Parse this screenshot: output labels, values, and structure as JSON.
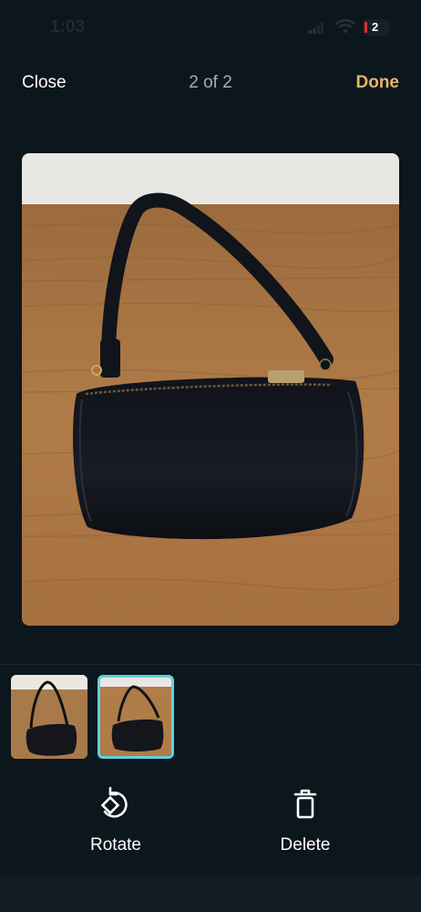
{
  "status_bar": {
    "time": "1:03",
    "battery": "2"
  },
  "nav": {
    "close_label": "Close",
    "counter": "2 of 2",
    "done_label": "Done"
  },
  "photos": [
    {
      "icon": "handbag-photo",
      "selected": false
    },
    {
      "icon": "handbag-photo",
      "selected": true
    }
  ],
  "actions": {
    "rotate_label": "Rotate",
    "delete_label": "Delete"
  },
  "colors": {
    "accent": "#e9b36a",
    "selection": "#5dd3e0",
    "background": "#0c161d"
  }
}
